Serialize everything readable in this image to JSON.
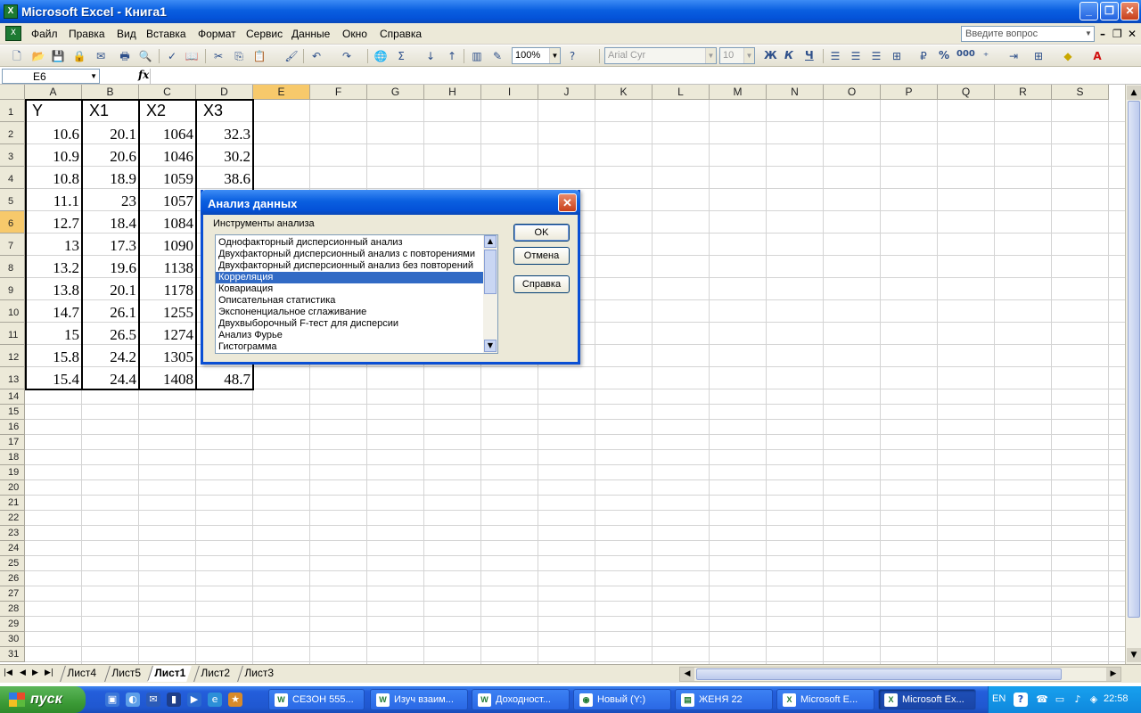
{
  "window": {
    "title": "Microsoft Excel - Книга1"
  },
  "menu": {
    "items": [
      "Файл",
      "Правка",
      "Вид",
      "Вставка",
      "Формат",
      "Сервис",
      "Данные",
      "Окно",
      "Справка"
    ],
    "ask_placeholder": "Введите вопрос"
  },
  "toolbar": {
    "zoom": "100%",
    "font": "Arial Cyr",
    "font_size": "10",
    "bold": "Ж",
    "italic": "К",
    "underline": "Ч",
    "percent": "%",
    "thousands": "000"
  },
  "formula_bar": {
    "cell_ref": "E6",
    "fx": "fx",
    "content": ""
  },
  "columns": [
    "A",
    "B",
    "C",
    "D",
    "E",
    "F",
    "G",
    "H",
    "I",
    "J",
    "K",
    "L",
    "M",
    "N",
    "O",
    "P",
    "Q",
    "R",
    "S"
  ],
  "active_col": "E",
  "active_row": 6,
  "rows": [
    "1",
    "2",
    "3",
    "4",
    "5",
    "6",
    "7",
    "8",
    "9",
    "10",
    "11",
    "12",
    "13",
    "14",
    "15",
    "16",
    "17",
    "18",
    "19",
    "20",
    "21",
    "22",
    "23",
    "24",
    "25",
    "26",
    "27",
    "28",
    "29",
    "30",
    "31"
  ],
  "table": {
    "headers": [
      "Y",
      "X1",
      "X2",
      "X3"
    ],
    "rows": [
      [
        "10.6",
        "20.1",
        "1064",
        "32.3"
      ],
      [
        "10.9",
        "20.6",
        "1046",
        "30.2"
      ],
      [
        "10.8",
        "18.9",
        "1059",
        "38.6"
      ],
      [
        "11.1",
        "23",
        "1057",
        ""
      ],
      [
        "12.7",
        "18.4",
        "1084",
        ""
      ],
      [
        "13",
        "17.3",
        "1090",
        ""
      ],
      [
        "13.2",
        "19.6",
        "1138",
        ""
      ],
      [
        "13.8",
        "20.1",
        "1178",
        ""
      ],
      [
        "14.7",
        "26.1",
        "1255",
        ""
      ],
      [
        "15",
        "26.5",
        "1274",
        ""
      ],
      [
        "15.8",
        "24.2",
        "1305",
        ""
      ],
      [
        "15.4",
        "24.4",
        "1408",
        "48.7"
      ]
    ]
  },
  "sheet_tabs": [
    {
      "label": "Лист4",
      "active": false
    },
    {
      "label": "Лист5",
      "active": false
    },
    {
      "label": "Лист1",
      "active": true
    },
    {
      "label": "Лист2",
      "active": false
    },
    {
      "label": "Лист3",
      "active": false
    }
  ],
  "dialog": {
    "title": "Анализ данных",
    "list_label": "Инструменты анализа",
    "items": [
      "Однофакторный дисперсионный анализ",
      "Двухфакторный дисперсионный анализ с повторениями",
      "Двухфакторный дисперсионный анализ без повторений",
      "Корреляция",
      "Ковариация",
      "Описательная статистика",
      "Экспоненциальное сглаживание",
      "Двухвыборочный F-тест для дисперсии",
      "Анализ Фурье",
      "Гистограмма"
    ],
    "selected_index": 3,
    "ok_label": "OK",
    "cancel_label": "Отмена",
    "help_label": "Справка"
  },
  "taskbar": {
    "start_label": "пуск",
    "tasks": [
      {
        "label": "СЕЗОН 555...",
        "active": false
      },
      {
        "label": "Изуч взаим...",
        "active": false
      },
      {
        "label": "Доходност...",
        "active": false
      },
      {
        "label": "Новый (Y:)",
        "active": false
      },
      {
        "label": "ЖЕНЯ 22",
        "active": false
      },
      {
        "label": "Microsoft E...",
        "active": false
      },
      {
        "label": "Microsoft Ex...",
        "active": true
      }
    ],
    "lang": "EN",
    "clock": "22:58"
  }
}
